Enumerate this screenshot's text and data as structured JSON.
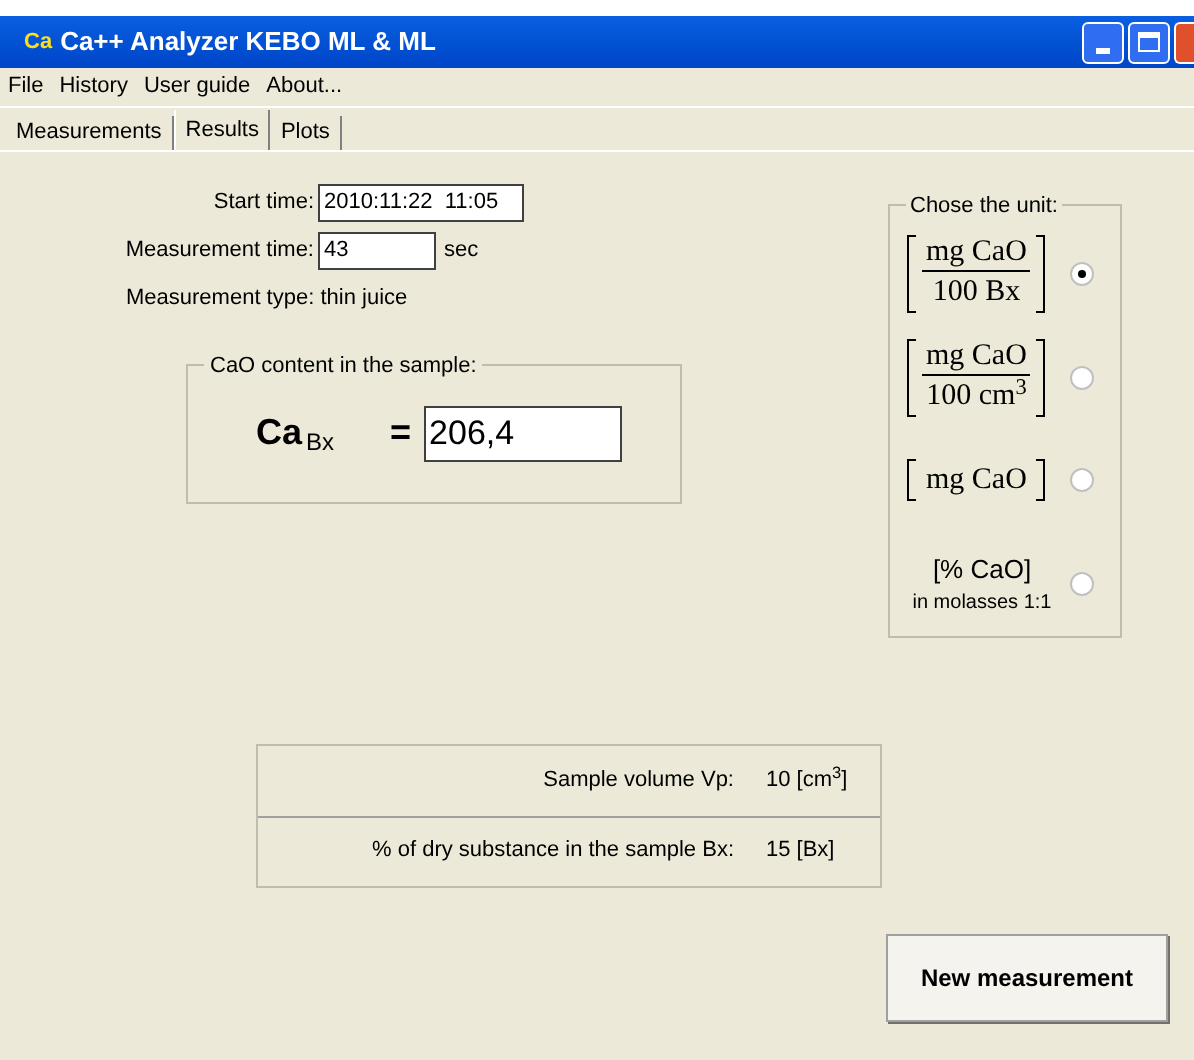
{
  "window": {
    "title": "Ca++ Analyzer KEBO ML & ML",
    "icon_text": "Ca"
  },
  "menu": [
    {
      "label": "File"
    },
    {
      "label": "History"
    },
    {
      "label": "User guide"
    },
    {
      "label": "About..."
    }
  ],
  "tabs": [
    {
      "label": "Measurements",
      "selected": false
    },
    {
      "label": "Results",
      "selected": true
    },
    {
      "label": "Plots",
      "selected": false
    }
  ],
  "fields": {
    "start_time": {
      "label": "Start time:",
      "value": "2010:11:22  11:05"
    },
    "measurement_time": {
      "label": "Measurement time:",
      "value": "43",
      "unit": "sec"
    },
    "measurement_type": "Measurement type: thin juice"
  },
  "content": {
    "title": "CaO content in the sample:",
    "symbol": "Ca",
    "subscript": "Bx",
    "equals": "=",
    "value": "206,4"
  },
  "unit_group": {
    "title": "Chose the unit:",
    "options": [
      {
        "kind": "fraction",
        "numerator": "mg CaO",
        "denominator": "100 Bx",
        "selected": true
      },
      {
        "kind": "fraction",
        "numerator": "mg CaO",
        "denominator": "100 cm$^{3}$",
        "selected": false
      },
      {
        "kind": "bracket",
        "text": "mg CaO",
        "selected": false
      },
      {
        "kind": "percent",
        "text": "[% CaO]",
        "note": "in molasses 1:1",
        "selected": false
      }
    ]
  },
  "params": [
    {
      "label": "Sample volume Vp:",
      "value": "10 [cm$^{3}$]"
    },
    {
      "label": "% of dry substance in the sample Bx:",
      "value": "15 [Bx]"
    }
  ],
  "button": "New measurement"
}
